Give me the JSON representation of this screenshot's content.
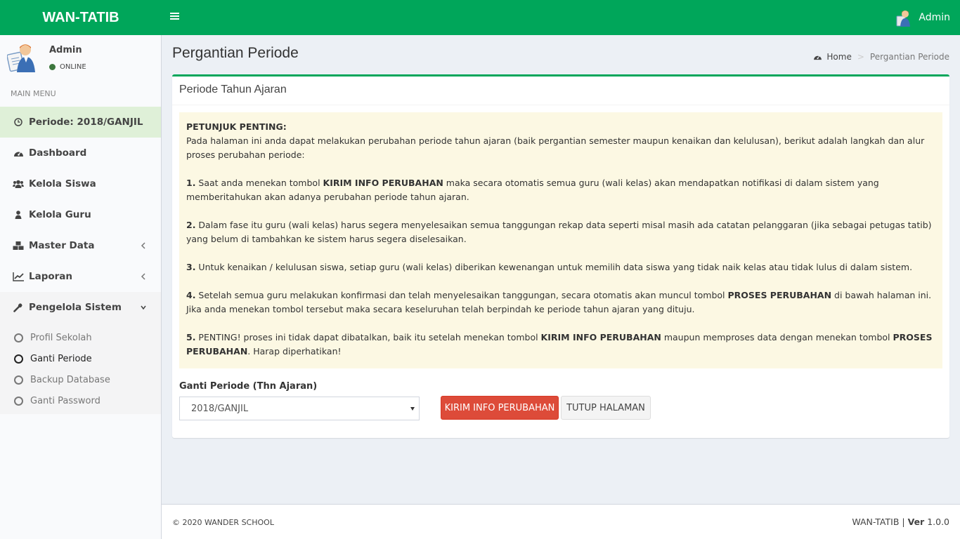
{
  "header": {
    "brand": "WAN-TATIB",
    "user_name": "Admin"
  },
  "sidebar": {
    "user_name": "Admin",
    "user_status": "ONLINE",
    "menu_header": "MAIN MENU",
    "items": [
      {
        "label": "Periode: 2018/GANJIL",
        "icon": "clock-icon"
      },
      {
        "label": "Dashboard",
        "icon": "dashboard-icon"
      },
      {
        "label": "Kelola Siswa",
        "icon": "users-icon"
      },
      {
        "label": "Kelola Guru",
        "icon": "user-icon"
      },
      {
        "label": "Master Data",
        "icon": "cubes-icon"
      },
      {
        "label": "Laporan",
        "icon": "line-chart-icon"
      },
      {
        "label": "Pengelola Sistem",
        "icon": "wrench-icon"
      }
    ],
    "submenu": [
      {
        "label": "Profil Sekolah"
      },
      {
        "label": "Ganti Periode"
      },
      {
        "label": "Backup Database"
      },
      {
        "label": "Ganti Password"
      }
    ]
  },
  "page": {
    "title": "Pergantian Periode",
    "breadcrumb_home": "Home",
    "breadcrumb_sep": ">",
    "breadcrumb_current": "Pergantian Periode"
  },
  "box": {
    "title": "Periode Tahun Ajaran"
  },
  "callout": {
    "heading": "PETUNJUK PENTING:",
    "intro": "Pada halaman ini anda dapat melakukan perubahan periode tahun ajaran (baik pergantian semester maupun kenaikan dan kelulusan), berikut adalah langkah dan alur proses perubahan periode:",
    "s1_num": "1.",
    "s1_a": " Saat anda menekan tombol ",
    "s1_b": "KIRIM INFO PERUBAHAN",
    "s1_c": " maka secara otomatis semua guru (wali kelas) akan mendapatkan notifikasi di dalam sistem yang memberitahukan akan adanya perubahan periode tahun ajaran.",
    "s2_num": "2.",
    "s2_a": " Dalam fase itu guru (wali kelas) harus segera menyelesaikan semua tanggungan rekap data seperti misal masih ada catatan pelanggaran (jika sebagai petugas tatib) yang belum di tambahkan ke sistem harus segera diselesaikan.",
    "s3_num": "3.",
    "s3_a": " Untuk kenaikan / kelulusan siswa, setiap guru (wali kelas) diberikan kewenangan untuk memilih data siswa yang tidak naik kelas atau tidak lulus di dalam sistem.",
    "s4_num": "4.",
    "s4_a": " Setelah semua guru melakukan konfirmasi dan telah menyelesaikan tanggungan, secara otomatis akan muncul tombol ",
    "s4_b": "PROSES PERUBAHAN",
    "s4_c": " di bawah halaman ini. Jika anda menekan tombol tersebut maka secara keseluruhan telah berpindah ke periode tahun ajaran yang dituju.",
    "s5_num": "5.",
    "s5_a": " PENTING! proses ini tidak dapat dibatalkan, baik itu setelah menekan tombol ",
    "s5_b": "KIRIM INFO PERUBAHAN",
    "s5_c": " maupun memproses data dengan menekan tombol ",
    "s5_d": "PROSES PERUBAHAN",
    "s5_e": ". Harap diperhatikan!"
  },
  "form": {
    "label": "Ganti Periode (Thn Ajaran)",
    "selected": "2018/GANJIL",
    "btn_kirim": "KIRIM INFO PERUBAHAN",
    "btn_tutup": "TUTUP HALAMAN"
  },
  "footer": {
    "copyright": "© 2020   WANDER SCHOOL",
    "app": "WAN-TATIB | ",
    "ver_label": "Ver",
    "ver_value": " 1.0.0"
  },
  "colors": {
    "header_green": "#00a65a",
    "periode_bg": "#dff0d8",
    "callout_bg": "#fcf8e3",
    "danger": "#dd4b39"
  }
}
